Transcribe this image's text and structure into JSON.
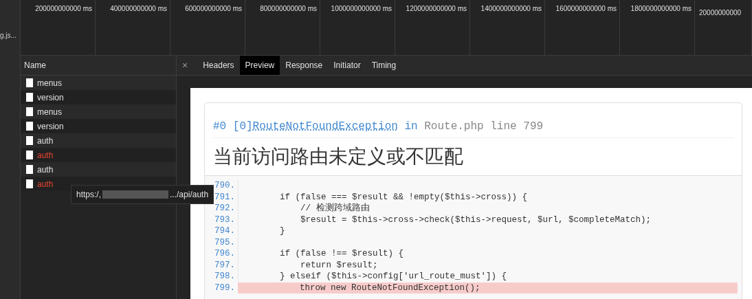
{
  "timeline": {
    "ticks": [
      "200000000000 ms",
      "400000000000 ms",
      "600000000000 ms",
      "800000000000 ms",
      "1000000000000 ms",
      "1200000000000 ms",
      "1400000000000 ms",
      "1600000000000 ms",
      "1800000000000 ms",
      "20000000000"
    ]
  },
  "left_strip": {
    "label": "g.js..."
  },
  "requests": {
    "header": "Name",
    "rows": [
      {
        "name": "menus",
        "failed": false
      },
      {
        "name": "version",
        "failed": false
      },
      {
        "name": "menus",
        "failed": false
      },
      {
        "name": "version",
        "failed": false
      },
      {
        "name": "auth",
        "failed": false
      },
      {
        "name": "auth",
        "failed": true
      },
      {
        "name": "auth",
        "failed": false
      },
      {
        "name": "auth",
        "failed": true
      }
    ]
  },
  "tooltip": {
    "prefix": "https:/,",
    "suffix": ".../api/auth"
  },
  "tabs": [
    {
      "label": "Headers",
      "selected": false
    },
    {
      "label": "Preview",
      "selected": true
    },
    {
      "label": "Response",
      "selected": false
    },
    {
      "label": "Initiator",
      "selected": false
    },
    {
      "label": "Timing",
      "selected": false
    }
  ],
  "close_tab": "×",
  "preview": {
    "trace_prefix": "#0 [0]",
    "exception": "RouteNotFoundException",
    "trace_in": "in",
    "location": "Route.php line 799",
    "message": "当前访问路由未定义或不匹配",
    "code": [
      {
        "number": "790.",
        "highlighted": false
      },
      {
        "number": "791.",
        "text": "        if (false === $result && !empty($this->cross)) {",
        "highlighted": false
      },
      {
        "number": "792.",
        "text": "            // 检测跨域路由",
        "highlighted": false
      },
      {
        "number": "793.",
        "text": "            $result = $this->cross->check($this->request, $url, $completeMatch);",
        "highlighted": false
      },
      {
        "number": "794.",
        "text": "        }",
        "highlighted": false
      },
      {
        "number": "795.",
        "highlighted": false
      },
      {
        "number": "796.",
        "text": "        if (false !== $result) {",
        "highlighted": false
      },
      {
        "number": "797.",
        "text": "            return $result;",
        "highlighted": false
      },
      {
        "number": "798.",
        "text": "        } elseif ($this->config['url_route_must']) {",
        "highlighted": false
      },
      {
        "number": "799.",
        "text": "            throw new RouteNotFoundException();",
        "highlighted": true
      }
    ]
  }
}
